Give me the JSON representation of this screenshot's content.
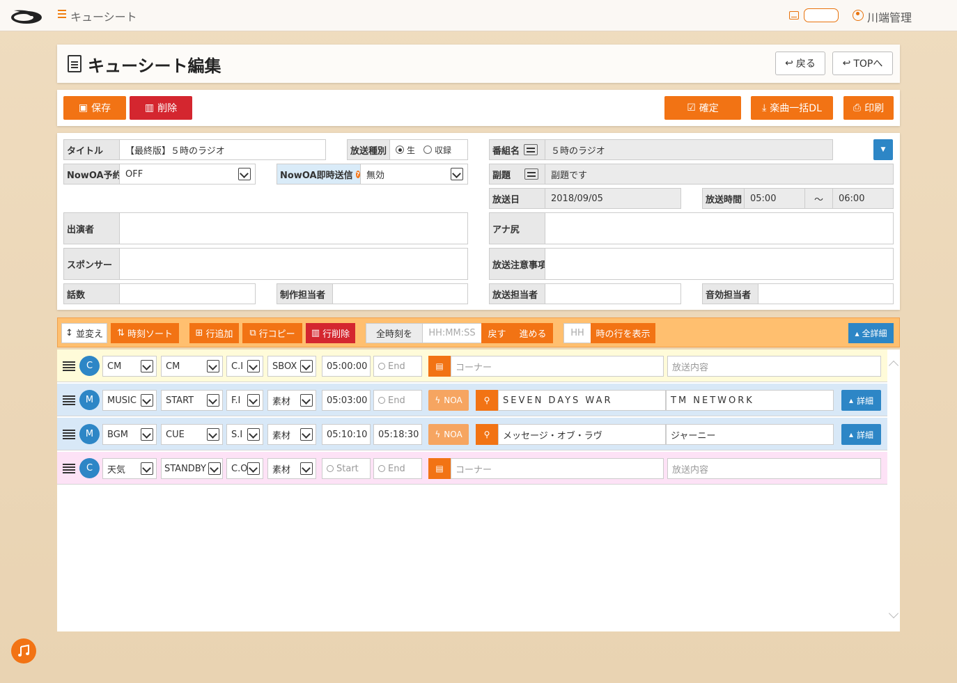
{
  "app": {
    "title": "キューシート",
    "user": "川端管理"
  },
  "page": {
    "title": "キューシート編集",
    "back_label": "戻る",
    "top_label": "TOPへ"
  },
  "actions": {
    "save": "保存",
    "delete": "削除",
    "confirm": "確定",
    "download": "楽曲一括DL",
    "print": "印刷"
  },
  "form": {
    "title_label": "タイトル",
    "title_value": "【最終版】５時のラジオ",
    "type_label": "放送種別",
    "type_live": "生",
    "type_recorded": "収録",
    "program_label": "番組名",
    "program_value": "５時のラジオ",
    "nowoa_label": "NowOA予約",
    "nowoa_value": "OFF",
    "nowoa_send_label": "NowOA即時送信",
    "nowoa_send_value": "無効",
    "subtitle_label": "副題",
    "subtitle_value": "副題です",
    "date_label": "放送日",
    "date_value": "2018/09/05",
    "time_label": "放送時間",
    "time_start": "05:00",
    "time_sep": "〜",
    "time_end": "06:00",
    "cast_label": "出演者",
    "ana_label": "アナ尻",
    "sponsor_label": "スポンサー",
    "notes_label": "放送注意事項",
    "episode_label": "話数",
    "producer_label": "制作担当者",
    "broadcaster_label": "放送担当者",
    "sound_label": "音効担当者"
  },
  "toolbar": {
    "reorder": "並変え",
    "time_sort": "時刻ソート",
    "add_row": "行追加",
    "copy_row": "行コピー",
    "delete_row": "行削除",
    "all_time": "全時刻を",
    "time_placeholder": "HH:MM:SS",
    "back": "戻す",
    "forward": "進める",
    "hour_placeholder": "HH",
    "show_hour_rows": "時の行を表示",
    "all_details": "全詳細"
  },
  "rows": [
    {
      "badge": "C",
      "type": "CM",
      "sub": "CM",
      "fx": "C.I",
      "src": "SBOX",
      "start": "05:00:00",
      "end": "End",
      "corner": "コーナー",
      "content": "放送内容"
    },
    {
      "badge": "M",
      "type": "MUSIC",
      "sub": "START",
      "fx": "F.I",
      "src": "素材",
      "start": "05:03:00",
      "end": "End",
      "noa": "NOA",
      "song": "SEVEN DAYS WAR",
      "artist": "TM NETWORK",
      "detail": "詳細"
    },
    {
      "badge": "M",
      "type": "BGM",
      "sub": "CUE",
      "fx": "S.I",
      "src": "素材",
      "start": "05:10:10",
      "end": "05:18:30",
      "noa": "NOA",
      "song": "メッセージ・オブ・ラヴ",
      "artist": "ジャーニー",
      "detail": "詳細"
    },
    {
      "badge": "C",
      "type": "天気",
      "sub": "STANDBY",
      "fx": "C.O",
      "src": "素材",
      "start": "Start",
      "end": "End",
      "corner": "コーナー",
      "content": "放送内容"
    }
  ],
  "colors": {
    "accent": "#f27314",
    "danger": "#d4262f",
    "info": "#2d86c6"
  }
}
